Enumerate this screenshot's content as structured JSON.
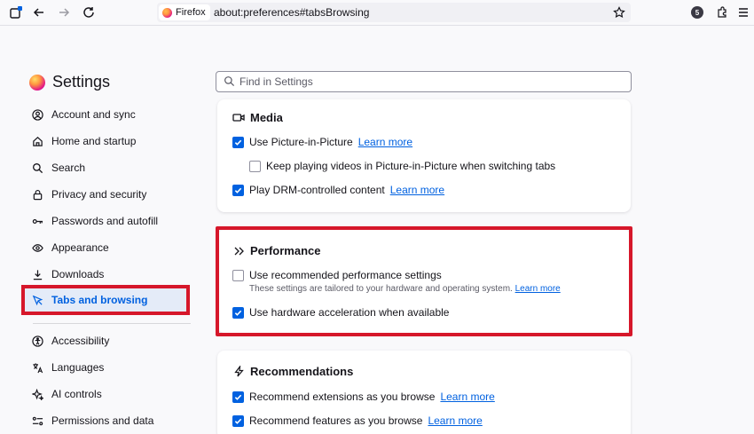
{
  "toolbar": {
    "identity_label": "Firefox",
    "url": "about:preferences#tabsBrowsing",
    "avatar_letter": "5"
  },
  "sidebar": {
    "title": "Settings",
    "items": [
      {
        "label": "Account and sync",
        "icon": "account-icon"
      },
      {
        "label": "Home and startup",
        "icon": "home-icon"
      },
      {
        "label": "Search",
        "icon": "search-icon"
      },
      {
        "label": "Privacy and security",
        "icon": "lock-icon"
      },
      {
        "label": "Passwords and autofill",
        "icon": "key-icon"
      },
      {
        "label": "Appearance",
        "icon": "eye-icon"
      },
      {
        "label": "Downloads",
        "icon": "download-icon"
      },
      {
        "label": "Tabs and browsing",
        "icon": "cursor-icon",
        "selected": true
      },
      {
        "label": "Accessibility",
        "icon": "accessibility-icon"
      },
      {
        "label": "Languages",
        "icon": "translate-icon"
      },
      {
        "label": "AI controls",
        "icon": "sparkle-icon"
      },
      {
        "label": "Permissions and data",
        "icon": "permissions-icon"
      }
    ]
  },
  "search": {
    "placeholder": "Find in Settings"
  },
  "media": {
    "title": "Media",
    "pip_label": "Use Picture-in-Picture",
    "pip_checked": true,
    "pip_link": "Learn more",
    "keep_playing_label": "Keep playing videos in Picture-in-Picture when switching tabs",
    "keep_playing_checked": false,
    "drm_label": "Play DRM-controlled content",
    "drm_checked": true,
    "drm_link": "Learn more"
  },
  "performance": {
    "title": "Performance",
    "recommended_label": "Use recommended performance settings",
    "recommended_checked": false,
    "recommended_desc": "These settings are tailored to your hardware and operating system.",
    "recommended_link": "Learn more",
    "hw_accel_label": "Use hardware acceleration when available",
    "hw_accel_checked": true
  },
  "recommendations": {
    "title": "Recommendations",
    "extensions_label": "Recommend extensions as you browse",
    "extensions_checked": true,
    "extensions_link": "Learn more",
    "features_label": "Recommend features as you browse",
    "features_checked": true,
    "features_link": "Learn more"
  },
  "colors": {
    "accent": "#0061e0",
    "highlight": "#d6172a",
    "selected_bg": "#e4ebf8"
  }
}
